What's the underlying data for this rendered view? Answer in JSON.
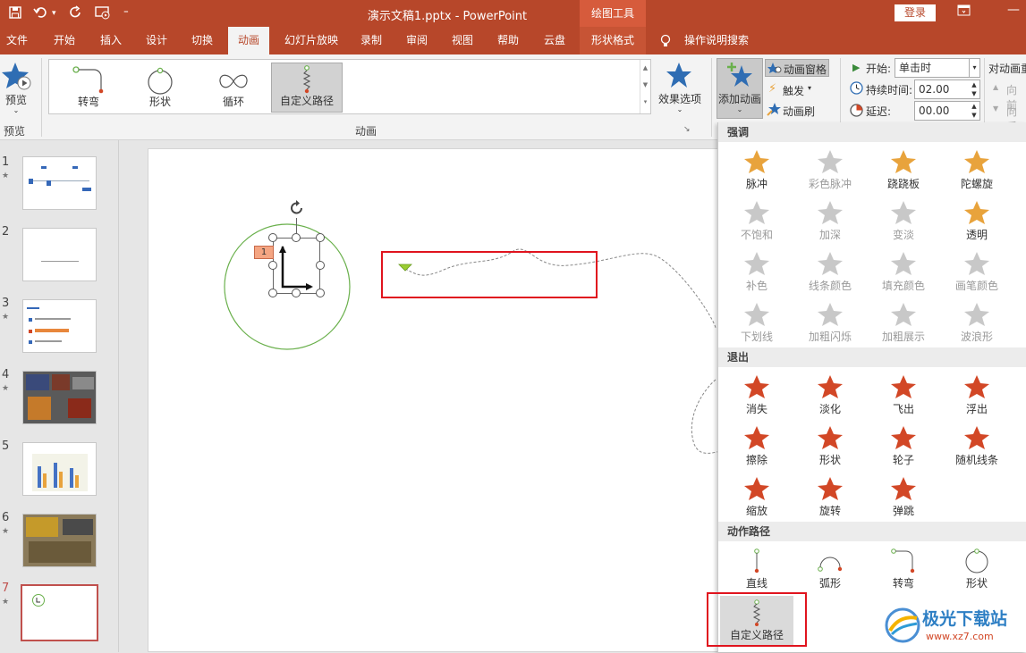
{
  "title_bar": {
    "document_title": "演示文稿1.pptx  -  PowerPoint",
    "context_tools": "绘图工具",
    "login": "登录",
    "save_icon": "save-icon",
    "undo_icon": "undo-icon",
    "redo_icon": "repeat-icon"
  },
  "tabs": [
    "文件",
    "开始",
    "插入",
    "设计",
    "切换",
    "动画",
    "幻灯片放映",
    "录制",
    "审阅",
    "视图",
    "帮助",
    "云盘",
    "形状格式",
    "操作说明搜索"
  ],
  "ribbon": {
    "preview": {
      "label": "预览",
      "group": "预览"
    },
    "animations": {
      "items": [
        "转弯",
        "形状",
        "循环",
        "自定义路径"
      ],
      "selected": "自定义路径",
      "group": "动画"
    },
    "effect_options": "效果选项",
    "add_animation": "添加动画",
    "animation_pane": "动画窗格",
    "trigger": "触发",
    "animation_painter": "动画刷",
    "timing": {
      "start_label": "开始:",
      "start_value": "单击时",
      "duration_label": "持续时间:",
      "duration_value": "02.00",
      "delay_label": "延迟:",
      "delay_value": "00.00",
      "reorder_label": "对动画重",
      "move_earlier": "向前",
      "move_later": "向后"
    }
  },
  "slides": [
    {
      "num": "1",
      "star": "★"
    },
    {
      "num": "2",
      "star": ""
    },
    {
      "num": "3",
      "star": "★"
    },
    {
      "num": "4",
      "star": "★"
    },
    {
      "num": "5",
      "star": ""
    },
    {
      "num": "6",
      "star": "★"
    },
    {
      "num": "7",
      "star": "★"
    }
  ],
  "slide_canvas": {
    "anim_tag": "1"
  },
  "gallery": {
    "emphasis": {
      "title": "强调",
      "items": [
        "脉冲",
        "彩色脉冲",
        "跷跷板",
        "陀螺旋",
        "不饱和",
        "加深",
        "变淡",
        "透明",
        "补色",
        "线条颜色",
        "填充颜色",
        "画笔颜色",
        "下划线",
        "加粗闪烁",
        "加粗展示",
        "波浪形"
      ]
    },
    "exit": {
      "title": "退出",
      "items": [
        "消失",
        "淡化",
        "飞出",
        "浮出",
        "擦除",
        "形状",
        "轮子",
        "随机线条",
        "缩放",
        "旋转",
        "弹跳"
      ]
    },
    "motion_paths": {
      "title": "动作路径",
      "items": [
        "直线",
        "弧形",
        "转弯",
        "形状",
        "自定义路径"
      ]
    }
  },
  "watermark": {
    "brand": "极光下载站",
    "url": "www.xz7.com"
  },
  "colors": {
    "accent": "#b7472a",
    "highlight": "#e0141e",
    "gold": "#e8a33c",
    "exit_red": "#d24726",
    "path_green": "#6ab04c"
  }
}
